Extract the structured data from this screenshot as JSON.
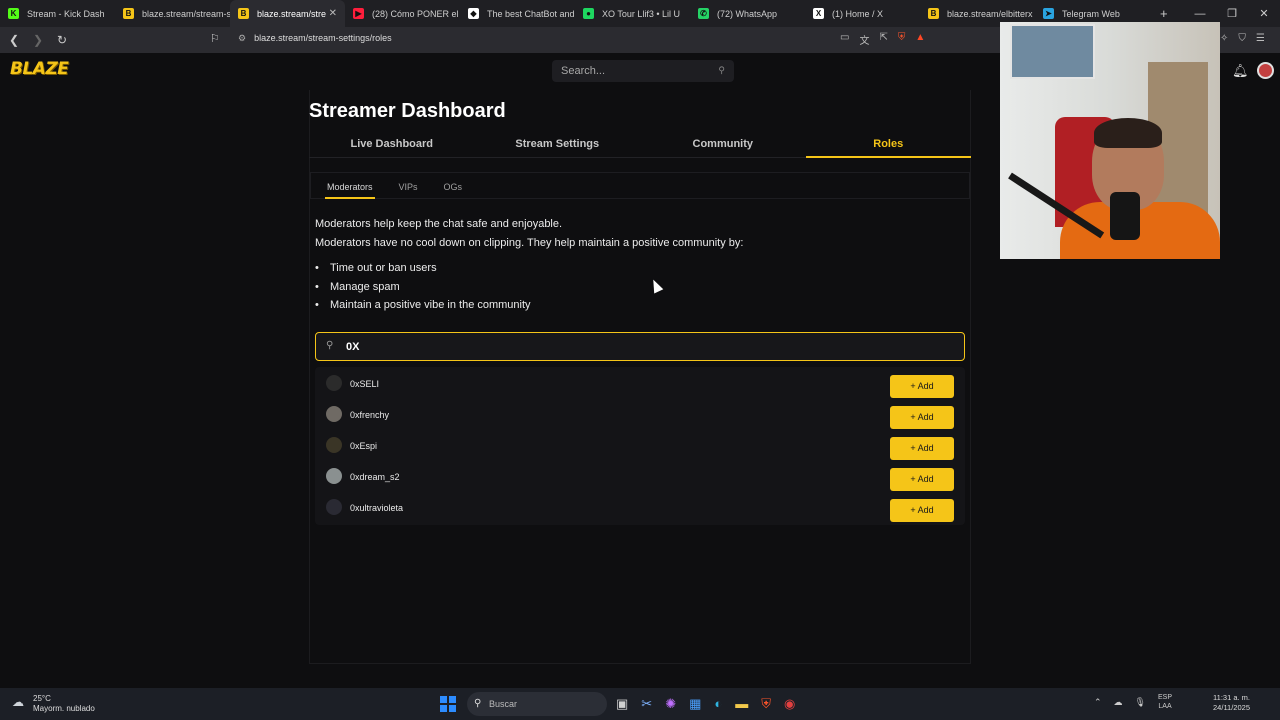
{
  "browser": {
    "tabs": [
      {
        "title": "Stream - Kick Dash",
        "fav": "K",
        "color": "#53fc18"
      },
      {
        "title": "blaze.stream/stream-s",
        "fav": "B",
        "color": "#f5c518"
      },
      {
        "title": "blaze.stream/stre",
        "fav": "B",
        "color": "#f5c518",
        "active": true
      },
      {
        "title": "(28) Cómo PONER el C",
        "fav": "▶",
        "color": "#ff1e3c"
      },
      {
        "title": "The best ChatBot and",
        "fav": "◆",
        "color": "#ffffff"
      },
      {
        "title": "XO Tour Llif3 • Lil U",
        "fav": "●",
        "color": "#1ed760"
      },
      {
        "title": "(72) WhatsApp",
        "fav": "✆",
        "color": "#25d366"
      },
      {
        "title": "(1) Home / X",
        "fav": "X",
        "color": "#ffffff"
      },
      {
        "title": "blaze.stream/elbitterx",
        "fav": "B",
        "color": "#f5c518"
      },
      {
        "title": "Telegram Web",
        "fav": "➤",
        "color": "#2aa4e0"
      }
    ],
    "new_tab": "+",
    "url": "blaze.stream/stream-settings/roles"
  },
  "site": {
    "logo": "BLAZE",
    "search_placeholder": "Search..."
  },
  "dashboard": {
    "title": "Streamer Dashboard",
    "tabs": [
      "Live Dashboard",
      "Stream Settings",
      "Community",
      "Roles"
    ],
    "active_tab": "Roles",
    "subtabs": [
      "Moderators",
      "VIPs",
      "OGs"
    ],
    "active_subtab": "Moderators",
    "description_1": "Moderators help keep the chat safe and enjoyable.",
    "description_2": "Moderators have no cool down on clipping. They help maintain a positive community by:",
    "bullets": [
      "Time out or ban users",
      "Manage spam",
      "Maintain a positive vibe in the community"
    ],
    "search_value": "0X",
    "results": [
      {
        "name": "0xSELI",
        "avatar_color": "#2b2b2b"
      },
      {
        "name": "0xfrenchy",
        "avatar_color": "#6f6a64"
      },
      {
        "name": "0xEspi",
        "avatar_color": "#3a3526"
      },
      {
        "name": "0xdream_s2",
        "avatar_color": "#8a9090"
      },
      {
        "name": "0xultravioleta",
        "avatar_color": "#2a2a33"
      }
    ],
    "add_label": "+ Add"
  },
  "taskbar": {
    "temp": "25°C",
    "weather": "Mayorm. nublado",
    "search_label": "Buscar",
    "lang_1": "ESP",
    "lang_2": "LAA",
    "time": "11:31 a. m.",
    "date": "24/11/2025"
  },
  "colors": {
    "accent": "#f5c518",
    "background": "#0e0e10"
  }
}
